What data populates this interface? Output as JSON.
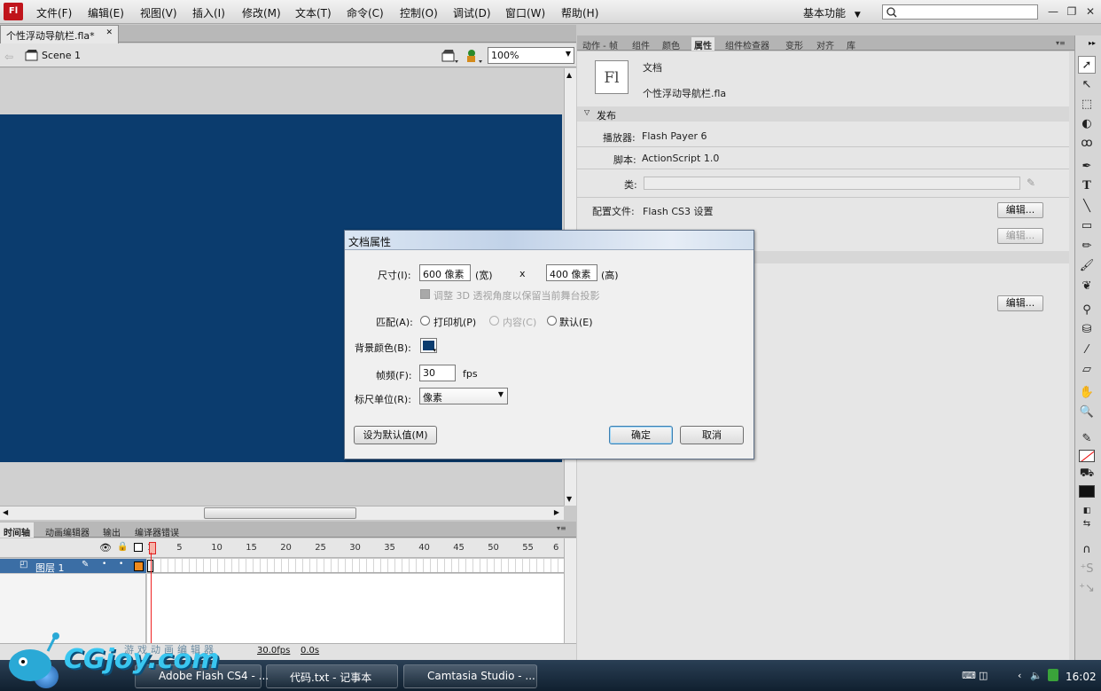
{
  "app": {
    "logo": "Fl"
  },
  "menu": [
    "文件(F)",
    "编辑(E)",
    "视图(V)",
    "插入(I)",
    "修改(M)",
    "文本(T)",
    "命令(C)",
    "控制(O)",
    "调试(D)",
    "窗口(W)",
    "帮助(H)"
  ],
  "workspace": {
    "label": "基本功能",
    "arrow": "▼"
  },
  "window_controls": {
    "minimize": "—",
    "restore": "❐",
    "close": "✕"
  },
  "document": {
    "tab_title": "个性浮动导航栏.fla*",
    "tab_close": "✕"
  },
  "editbar": {
    "scene": "Scene 1",
    "zoom": "100%"
  },
  "timeline": {
    "tabs": [
      "时间轴",
      "动画编辑器",
      "输出",
      "编译器错误"
    ],
    "frame_numbers": [
      "1",
      "5",
      "10",
      "15",
      "20",
      "25",
      "30",
      "35",
      "40",
      "45",
      "50",
      "55",
      "6"
    ],
    "layer_name": "图层 1",
    "fps": "30.0fps",
    "time": "0.0s"
  },
  "panel": {
    "tabs": [
      "动作 - 帧",
      "组件",
      "颜色",
      "属性",
      "组件检查器",
      "变形",
      "对齐",
      "库"
    ],
    "doc_icon": "Fl",
    "doc_type": "文档",
    "doc_name": "个性浮动导航栏.fla",
    "publish_header": "发布",
    "player_label": "播放器:",
    "player_value": "Flash Payer 6",
    "script_label": "脚本:",
    "script_value": "ActionScript 1.0",
    "class_label": "类:",
    "profile_label": "配置文件:",
    "profile_value": "Flash CS3 设置",
    "edit_button": "编辑...",
    "edit_button_2": "编辑...",
    "edit_button_3": "编辑..."
  },
  "dialog": {
    "title": "文档属性",
    "size_label": "尺寸(I):",
    "width_value": "600 像素",
    "width_suffix": "(宽)",
    "times": "x",
    "height_value": "400 像素",
    "height_suffix": "(高)",
    "adjust_3d": "调整 3D 透视角度以保留当前舞台投影",
    "match_label": "匹配(A):",
    "match_printer": "打印机(P)",
    "match_contents": "内容(C)",
    "match_default": "默认(E)",
    "bg_color_label": "背景颜色(B):",
    "bg_color": "#0b3c6e",
    "frame_rate_label": "帧频(F):",
    "frame_rate_value": "30",
    "fps_unit": "fps",
    "ruler_label": "标尺单位(R):",
    "ruler_value": "像素",
    "set_default_button": "设为默认值(M)",
    "ok_button": "确定",
    "cancel_button": "取消"
  },
  "taskbar": {
    "items": [
      "Adobe Flash CS4 - ...",
      "代码.txt - 记事本",
      "Camtasia Studio - ..."
    ],
    "clock": "16:02"
  },
  "watermark": {
    "main": "CGjoy.com",
    "sub": "游戏动画编辑器"
  },
  "colors": {
    "stage": "#0b3c6e",
    "accent": "#c0141b",
    "layer_selected": "#3b6ea5"
  }
}
